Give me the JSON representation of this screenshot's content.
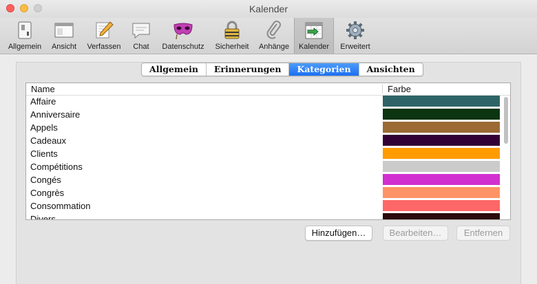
{
  "window": {
    "title": "Kalender"
  },
  "toolbar": {
    "items": [
      {
        "label": "Allgemein",
        "icon": "switch-icon"
      },
      {
        "label": "Ansicht",
        "icon": "window-icon"
      },
      {
        "label": "Verfassen",
        "icon": "pencil-icon"
      },
      {
        "label": "Chat",
        "icon": "chat-icon"
      },
      {
        "label": "Datenschutz",
        "icon": "mask-icon"
      },
      {
        "label": "Sicherheit",
        "icon": "lock-icon"
      },
      {
        "label": "Anhänge",
        "icon": "paperclip-icon"
      },
      {
        "label": "Kalender",
        "icon": "calendar-icon",
        "selected": true
      },
      {
        "label": "Erweitert",
        "icon": "gear-icon"
      }
    ]
  },
  "tabs": {
    "items": [
      "Allgemein",
      "Erinnerungen",
      "Kategorien",
      "Ansichten"
    ],
    "active": "Kategorien"
  },
  "list": {
    "headers": {
      "name": "Name",
      "color": "Farbe"
    },
    "rows": [
      {
        "name": "Affaire",
        "color": "#2e6466"
      },
      {
        "name": "Anniversaire",
        "color": "#0b3410"
      },
      {
        "name": "Appels",
        "color": "#9b6a35"
      },
      {
        "name": "Cadeaux",
        "color": "#320034"
      },
      {
        "name": "Clients",
        "color": "#fe9b00"
      },
      {
        "name": "Compétitions",
        "color": "#cbcbcb"
      },
      {
        "name": "Congés",
        "color": "#d12fcf"
      },
      {
        "name": "Congrès",
        "color": "#fe9466"
      },
      {
        "name": "Consommation",
        "color": "#fe6767"
      },
      {
        "name": "Divers",
        "color": "#2a0a0a"
      }
    ]
  },
  "buttons": {
    "add": "Hinzufügen…",
    "edit": "Bearbeiten…",
    "remove": "Entfernen"
  }
}
